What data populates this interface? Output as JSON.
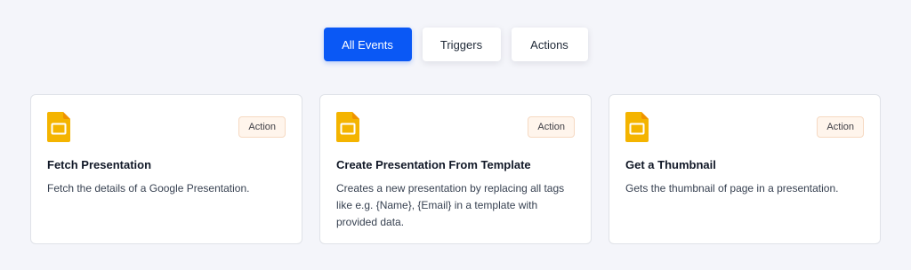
{
  "tabs": {
    "all_events": "All Events",
    "triggers": "Triggers",
    "actions": "Actions"
  },
  "colors": {
    "accent": "#0a58f5",
    "slides_yellow": "#f4b400",
    "badge_bg": "#fff5ec"
  },
  "cards": [
    {
      "icon": "google-slides-icon",
      "badge": "Action",
      "title": "Fetch Presentation",
      "description": "Fetch the details of a Google Presentation."
    },
    {
      "icon": "google-slides-icon",
      "badge": "Action",
      "title": "Create Presentation From Template",
      "description": "Creates a new presentation by replacing all tags like e.g. {Name}, {Email} in a template with provided data."
    },
    {
      "icon": "google-slides-icon",
      "badge": "Action",
      "title": "Get a Thumbnail",
      "description": "Gets the thumbnail of page in a presentation."
    }
  ]
}
